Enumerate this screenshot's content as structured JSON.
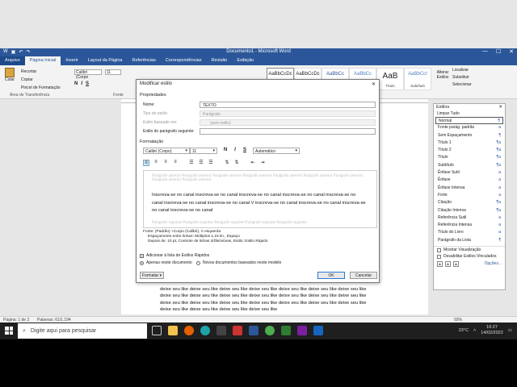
{
  "window": {
    "title": "Documento1 - Microsoft Word",
    "min": "—",
    "max": "☐",
    "close": "✕"
  },
  "tabs": [
    "Arquivo",
    "Página Inicial",
    "Inserir",
    "Layout da Página",
    "Referências",
    "Correspondências",
    "Revisão",
    "Exibição"
  ],
  "ribbon": {
    "paste": "Colar",
    "cut": "Recortar",
    "copy": "Copiar",
    "painter": "Pincel de Formatação",
    "clipboard_label": "Área de Transferência",
    "font_label": "Fonte",
    "font_name": "Calibri (Corpo",
    "font_size": "11",
    "fmt": [
      "N",
      "I",
      "S"
    ],
    "styles": [
      {
        "preview": "AaBbCcDc",
        "name": ""
      },
      {
        "preview": "AaBbCcDc",
        "name": ""
      },
      {
        "preview": "AaBbCc",
        "name": ""
      },
      {
        "preview": "AaBbCc",
        "name": ""
      },
      {
        "preview": "AaB",
        "name": "Título"
      },
      {
        "preview": "AaBbCcI",
        "name": "Subtítulo"
      }
    ],
    "change_styles": "Alterar Estilos",
    "find": "Localizar",
    "replace": "Substituir",
    "select": "Selecionar"
  },
  "statusbar": {
    "page": "Página: 1 de 2",
    "words": "Palavras: 61/1.194",
    "zoom": "93%"
  },
  "doc_text": "Dixe seu like deixe seu like deixe seu like deixe seu like deixe seu like deixe seu like deixe seu like deixe seu like deixe seu like deixe seu like deixe seu like deixe seu like deixe seu like deixe seu like deixe seu like deixe seu like deixe seu like deixe seu like deixe seu like deixe seu like deixe seu like deixe seu like deixe seu like deixe seu like deixe seu like deixe seu like deixe seu like deixe seu like deixe seu like deixe seu like deixe seu like deixe seu like",
  "styles_pane": {
    "title": "Estilos",
    "clear": "Limpar Tudo",
    "items": [
      {
        "name": "Normal",
        "mark": "¶"
      },
      {
        "name": "Fonte parág. padrão",
        "mark": "a"
      },
      {
        "name": "Sem Espaçamento",
        "mark": "¶"
      },
      {
        "name": "Título 1",
        "mark": "¶a"
      },
      {
        "name": "Título 2",
        "mark": "¶a"
      },
      {
        "name": "Título",
        "mark": "¶a"
      },
      {
        "name": "Subtítulo",
        "mark": "¶a"
      },
      {
        "name": "Ênfase Sutil",
        "mark": "a"
      },
      {
        "name": "Ênfase",
        "mark": "a"
      },
      {
        "name": "Ênfase Intensa",
        "mark": "a"
      },
      {
        "name": "Forte",
        "mark": "a"
      },
      {
        "name": "Citação",
        "mark": "¶a"
      },
      {
        "name": "Citação Intensa",
        "mark": "¶a"
      },
      {
        "name": "Referência Sutil",
        "mark": "a"
      },
      {
        "name": "Referência Intensa",
        "mark": "a"
      },
      {
        "name": "Título do Livro",
        "mark": "a"
      },
      {
        "name": "Parágrafo da Lista",
        "mark": "¶"
      }
    ],
    "preview_label": "Mostrar Visualização",
    "linked_label": "Desabilitar Estilos Vinculados",
    "options": "Opções..."
  },
  "dialog": {
    "title": "Modificar estilo",
    "close": "✕",
    "props_section": "Propriedades",
    "name_label": "Nome:",
    "name_value": "TEXTO",
    "type_label": "Tipo de estilo:",
    "type_value": "Parágrafo",
    "based_label": "Estilo baseado em:",
    "based_value": "(sem estilo)",
    "next_label": "Estilo do parágrafo seguinte:",
    "next_value": "",
    "format_section": "Formatação",
    "font": "Calibri (Corpo)",
    "size": "11",
    "color": "Automático",
    "prev_para": "Parágrafo anterior Parágrafo anterior Parágrafo anterior Parágrafo anterior Parágrafo anterior Parágrafo anterior Parágrafo anterior Parágrafo anterior Parágrafo anterior",
    "sample": "Inscreva-se no canal inscreva-se no canal inscreva-se no canal inscreva-se no canal inscreva-se no canal inscreva-se no canal inscreva-se no canal V inscreva-se no canal inscreva-se no canal inscreva-se no canal inscreva-se no canal",
    "next_para": "Parágrafo seguinte Parágrafo seguinte Parágrafo seguinte Parágrafo seguinte Parágrafo seguinte",
    "desc1": "Fonte: (Padrão) +Corpo (Calibri), À esquerda",
    "desc2": "Espaçamento entre linhas:  Múltiplos 1,15 lin., Espaço",
    "desc3": "Depois de:  10 pt, Controle de linhas órfãs/viúvas, Estilo: Estilo Rápido",
    "add_label": "Adicionar à lista de Estilos Rápidos",
    "only_doc": "Apenas neste documento",
    "new_docs": "Novos documentos baseados neste modelo",
    "format_btn": "Formatar ▾",
    "ok": "OK",
    "cancel": "Cancelar"
  },
  "taskbar": {
    "search_placeholder": "Digite aqui para pesquisar",
    "temp": "23°C",
    "time": "16:27",
    "date": "14/02/2022"
  }
}
